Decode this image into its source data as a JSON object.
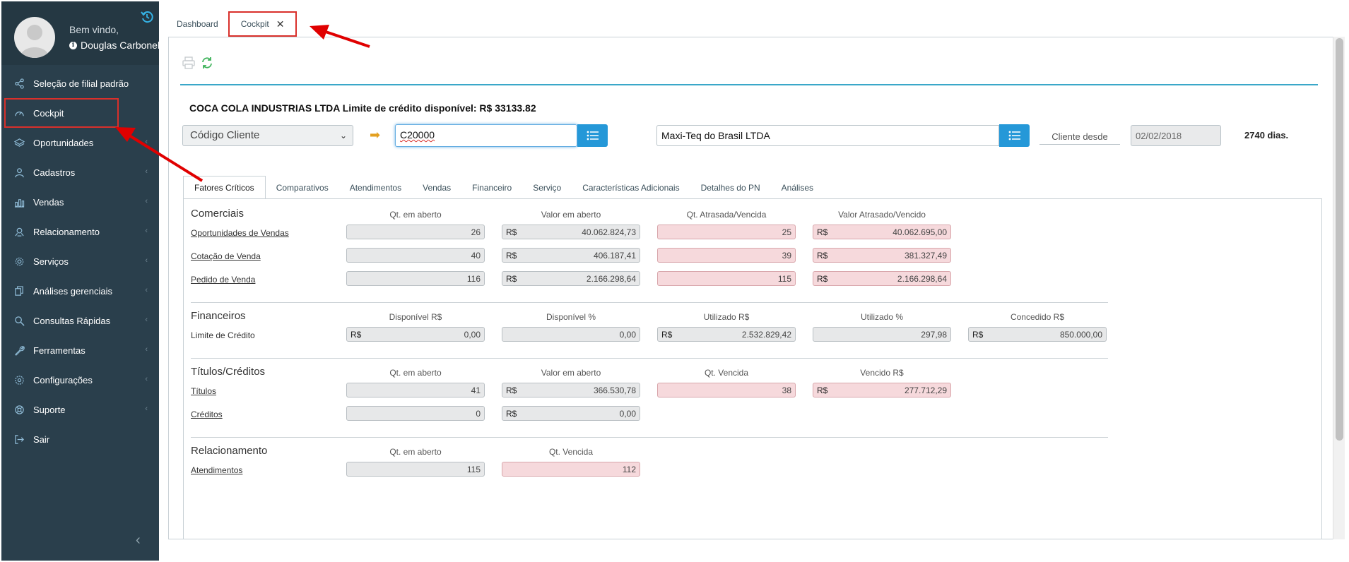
{
  "sidebar": {
    "welcome": "Bem vindo,",
    "username": "Douglas Carbonel",
    "items": [
      {
        "label": "Seleção de filial padrão",
        "icon": "share-icon"
      },
      {
        "label": "Cockpit",
        "icon": "gauge-icon"
      },
      {
        "label": "Oportunidades",
        "icon": "layers-icon"
      },
      {
        "label": "Cadastros",
        "icon": "user-icon"
      },
      {
        "label": "Vendas",
        "icon": "bar-chart-icon"
      },
      {
        "label": "Relacionamento",
        "icon": "handshake-icon"
      },
      {
        "label": "Serviços",
        "icon": "cog-icon"
      },
      {
        "label": "Análises gerenciais",
        "icon": "copy-icon"
      },
      {
        "label": "Consultas Rápidas",
        "icon": "search-icon"
      },
      {
        "label": "Ferramentas",
        "icon": "wrench-icon"
      },
      {
        "label": "Configurações",
        "icon": "gear-icon"
      },
      {
        "label": "Suporte",
        "icon": "lifebuoy-icon"
      },
      {
        "label": "Sair",
        "icon": "logout-icon"
      }
    ],
    "collapse_glyph": "‹"
  },
  "tabs": {
    "dashboard": "Dashboard",
    "cockpit": "Cockpit",
    "close_glyph": "✕"
  },
  "header": {
    "company": "COCA COLA INDUSTRIAS LTDA Limite de crédito disponível: R$ 33133.82",
    "select_value": "Código Cliente",
    "code_value": "C20000",
    "name_value": "Maxi-Teq do Brasil LTDA",
    "cliente_desde_label": "Cliente desde",
    "date_value": "02/02/2018",
    "days": "2740 dias."
  },
  "subtabs": [
    "Fatores Críticos",
    "Comparativos",
    "Atendimentos",
    "Vendas",
    "Financeiro",
    "Serviço",
    "Características Adicionais",
    "Detalhes do PN",
    "Análises"
  ],
  "currency": "R$",
  "comerciais": {
    "title": "Comerciais",
    "cols": [
      "Qt. em aberto",
      "Valor em aberto",
      "Qt. Atrasada/Vencida",
      "Valor Atrasado/Vencido"
    ],
    "rows": [
      {
        "label": "Oportunidades de Vendas",
        "qt": "26",
        "valor": "40.062.824,73",
        "qt_atr": "25",
        "valor_atr": "40.062.695,00"
      },
      {
        "label": "Cotação de Venda",
        "qt": "40",
        "valor": "406.187,41",
        "qt_atr": "39",
        "valor_atr": "381.327,49"
      },
      {
        "label": "Pedido de Venda",
        "qt": "116",
        "valor": "2.166.298,64",
        "qt_atr": "115",
        "valor_atr": "2.166.298,64"
      }
    ]
  },
  "financeiros": {
    "title": "Financeiros",
    "cols": [
      "Disponível R$",
      "Disponível %",
      "Utilizado R$",
      "Utilizado %",
      "Concedido R$"
    ],
    "row": {
      "label": "Limite de Crédito",
      "disp_rs": "0,00",
      "disp_pct": "0,00",
      "util_rs": "2.532.829,42",
      "util_pct": "297,98",
      "conc_rs": "850.000,00"
    }
  },
  "titulos": {
    "title": "Títulos/Créditos",
    "cols": [
      "Qt. em aberto",
      "Valor em aberto",
      "Qt. Vencida",
      "Vencido R$"
    ],
    "rows": [
      {
        "label": "Títulos",
        "qt": "41",
        "valor": "366.530,78",
        "qt_venc": "38",
        "venc_rs": "277.712,29"
      },
      {
        "label": "Créditos",
        "qt": "0",
        "valor": "0,00"
      }
    ]
  },
  "relacionamento": {
    "title": "Relacionamento",
    "cols": [
      "Qt. em aberto",
      "Qt. Vencida"
    ],
    "row": {
      "label": "Atendimentos",
      "qt": "115",
      "qt_venc": "112"
    }
  },
  "colors": {
    "sidebar": "#2a3f4c",
    "accent": "#2598d8",
    "highlight": "#d9302b",
    "alert_field": "#f6d9dc"
  }
}
